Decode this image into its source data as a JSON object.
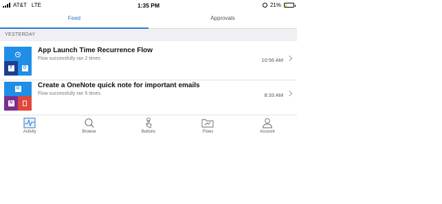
{
  "status_bar": {
    "carrier": "AT&T",
    "network": "LTE",
    "time": "1:35 PM",
    "battery": "21%",
    "battery_level": 0.21
  },
  "tabs": [
    {
      "label": "Feed",
      "active": true
    },
    {
      "label": "Approvals",
      "active": false
    }
  ],
  "section_header": "YESTERDAY",
  "feed_items": [
    {
      "title": "App Launch Time Recurrence Flow",
      "subtitle": "Flow successfully ran 2 times",
      "time": "10:56 AM",
      "icons": [
        "alarm-clock-icon",
        "teams-icon",
        "outlook-icon"
      ]
    },
    {
      "title": "Create a OneNote quick note for important emails",
      "subtitle": "Flow successfully ran 5 times",
      "time": "8:33 AM",
      "icons": [
        "outlook-icon",
        "onenote-icon",
        "office-icon"
      ]
    }
  ],
  "nav": [
    {
      "label": "Activity",
      "icon": "activity-icon"
    },
    {
      "label": "Browse",
      "icon": "search-icon"
    },
    {
      "label": "Buttons",
      "icon": "touch-icon"
    },
    {
      "label": "Flows",
      "icon": "folder-flow-icon"
    },
    {
      "label": "Account",
      "icon": "person-icon"
    }
  ],
  "colors": {
    "accent": "#2a78c9",
    "tile_blue": "#1f8ee6",
    "teams_dark": "#1c3f8f",
    "onenote_purple": "#7b2f8f",
    "office_red": "#e0463a"
  }
}
